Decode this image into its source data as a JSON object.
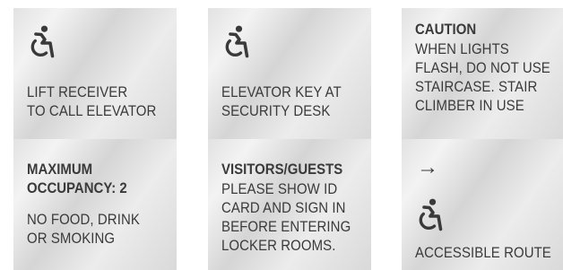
{
  "signs": [
    {
      "icon": "accessible-wheelchair-icon",
      "lines": [
        "LIFT RECEIVER",
        "TO CALL ELEVATOR"
      ]
    },
    {
      "icon": "accessible-wheelchair-icon",
      "lines": [
        "ELEVATOR KEY AT",
        "SECURITY DESK"
      ]
    },
    {
      "heading": "CAUTION",
      "lines": [
        "WHEN LIGHTS",
        "FLASH, DO NOT USE",
        "STAIRCASE. STAIR",
        "CLIMBER IN USE"
      ]
    },
    {
      "heading": [
        "MAXIMUM",
        "OCCUPANCY: 2"
      ],
      "lines": [
        "NO FOOD, DRINK",
        "OR SMOKING"
      ]
    },
    {
      "heading": "VISITORS/GUESTS",
      "lines": [
        "PLEASE SHOW ID",
        "CARD AND SIGN IN",
        "BEFORE ENTERING",
        "LOCKER ROOMS."
      ]
    },
    {
      "arrow": "→",
      "icon": "accessible-wheelchair-icon",
      "lines": [
        "ACCESSIBLE ROUTE"
      ]
    }
  ],
  "colors": {
    "text": "#3a3a3a",
    "plate_light": "#f3f3f3",
    "plate_dark": "#d5d5d5"
  }
}
